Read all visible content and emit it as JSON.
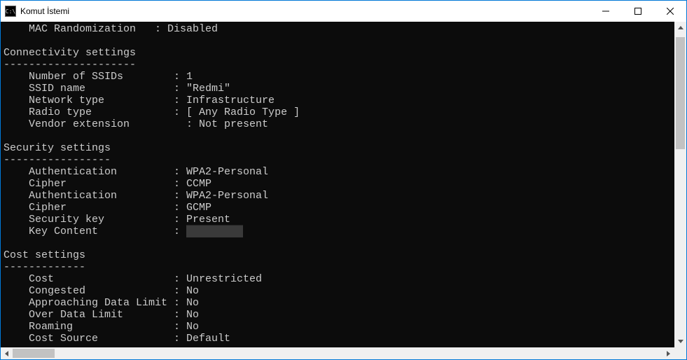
{
  "window": {
    "title": "Komut İstemi"
  },
  "output": {
    "mac_randomization": {
      "label": "MAC Randomization",
      "value": "Disabled"
    },
    "sections": {
      "connectivity": {
        "heading": "Connectivity settings",
        "dashes": "---------------------",
        "rows": [
          {
            "label": "Number of SSIDs",
            "value": "1"
          },
          {
            "label": "SSID name",
            "value": "\"Redmi\""
          },
          {
            "label": "Network type",
            "value": "Infrastructure"
          },
          {
            "label": "Radio type",
            "value": "[ Any Radio Type ]"
          },
          {
            "label": "Vendor extension",
            "value": "Not present",
            "indent_value": true
          }
        ]
      },
      "security": {
        "heading": "Security settings",
        "dashes": "-----------------",
        "rows": [
          {
            "label": "Authentication",
            "value": "WPA2-Personal"
          },
          {
            "label": "Cipher",
            "value": "CCMP"
          },
          {
            "label": "Authentication",
            "value": "WPA2-Personal"
          },
          {
            "label": "Cipher",
            "value": "GCMP"
          },
          {
            "label": "Security key",
            "value": "Present"
          },
          {
            "label": "Key Content",
            "value": "█████████",
            "redacted": true
          }
        ]
      },
      "cost": {
        "heading": "Cost settings",
        "dashes": "-------------",
        "rows": [
          {
            "label": "Cost",
            "value": "Unrestricted"
          },
          {
            "label": "Congested",
            "value": "No"
          },
          {
            "label": "Approaching Data Limit",
            "value": "No"
          },
          {
            "label": "Over Data Limit",
            "value": "No"
          },
          {
            "label": "Roaming",
            "value": "No"
          },
          {
            "label": "Cost Source",
            "value": "Default"
          }
        ]
      }
    }
  }
}
